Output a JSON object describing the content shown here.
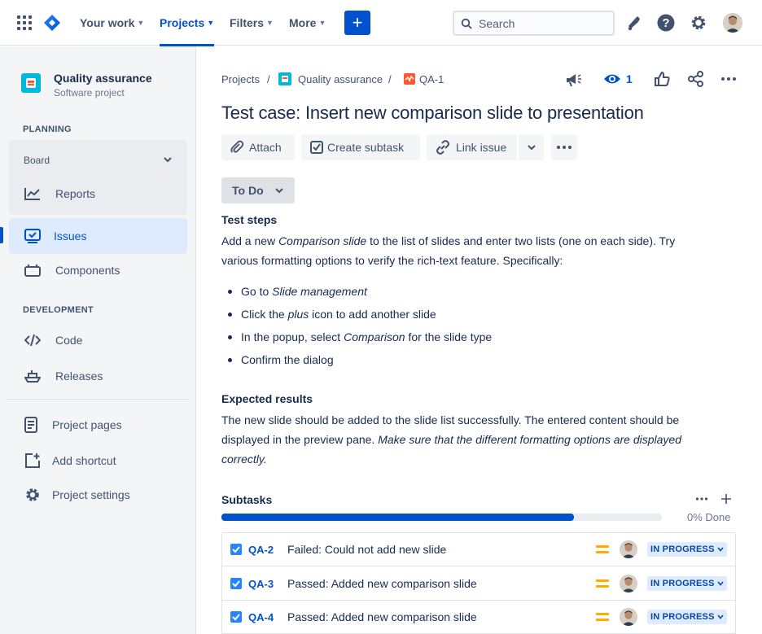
{
  "topnav": {
    "items": [
      {
        "label": "Your work"
      },
      {
        "label": "Projects"
      },
      {
        "label": "Filters"
      },
      {
        "label": "More"
      }
    ],
    "search_placeholder": "Search"
  },
  "sidebar": {
    "project_name": "Quality assurance",
    "project_type": "Software project",
    "planning_label": "PLANNING",
    "board_label": "Board",
    "reports_label": "Reports",
    "issues_label": "Issues",
    "components_label": "Components",
    "development_label": "DEVELOPMENT",
    "code_label": "Code",
    "releases_label": "Releases",
    "project_pages_label": "Project pages",
    "add_shortcut_label": "Add shortcut",
    "project_settings_label": "Project settings"
  },
  "breadcrumb": {
    "projects": "Projects",
    "project": "Quality assurance",
    "issue": "QA-1",
    "sep": "/"
  },
  "watchers_count": "1",
  "issue": {
    "title": "Test case: Insert new comparison slide to presentation",
    "status": "To Do"
  },
  "actions": {
    "attach": "Attach",
    "create_subtask": "Create subtask",
    "link_issue": "Link issue"
  },
  "test_steps": {
    "heading": "Test steps",
    "intro_1": "Add a new ",
    "intro_em": "Comparison slide",
    "intro_2": " to the list of slides and enter two lists (one on each side). Try",
    "intro_3": "various formatting options to verify the rich-text feature. Specifically:",
    "steps": [
      {
        "pre": "Go to ",
        "em": "Slide management",
        "post": ""
      },
      {
        "pre": "Click the ",
        "em": "plus",
        "post": " icon to add another slide"
      },
      {
        "pre": "In the popup, select ",
        "em": "Comparison",
        "post": " for the slide type"
      },
      {
        "pre": "Confirm the dialog",
        "em": "",
        "post": ""
      }
    ]
  },
  "expected": {
    "heading": "Expected results",
    "line1": "The new slide should be added to the slide list successfully. The entered content should be",
    "line2_plain": "displayed in the preview pane. ",
    "line2_em": "Make sure that the different formatting options are displayed",
    "line3_em": "correctly."
  },
  "subtasks": {
    "heading": "Subtasks",
    "progress_text": "0% Done",
    "progress_fill_fraction": 0.8,
    "items": [
      {
        "key": "QA-2",
        "title": "Failed: Could not add new slide",
        "status": "IN PROGRESS"
      },
      {
        "key": "QA-3",
        "title": "Passed: Added new comparison slide",
        "status": "IN PROGRESS"
      },
      {
        "key": "QA-4",
        "title": "Passed: Added new comparison slide",
        "status": "IN PROGRESS"
      }
    ]
  },
  "colors": {
    "brand": "#0052cc",
    "status_bg": "#deebff",
    "priority_medium": "#ffab00"
  }
}
